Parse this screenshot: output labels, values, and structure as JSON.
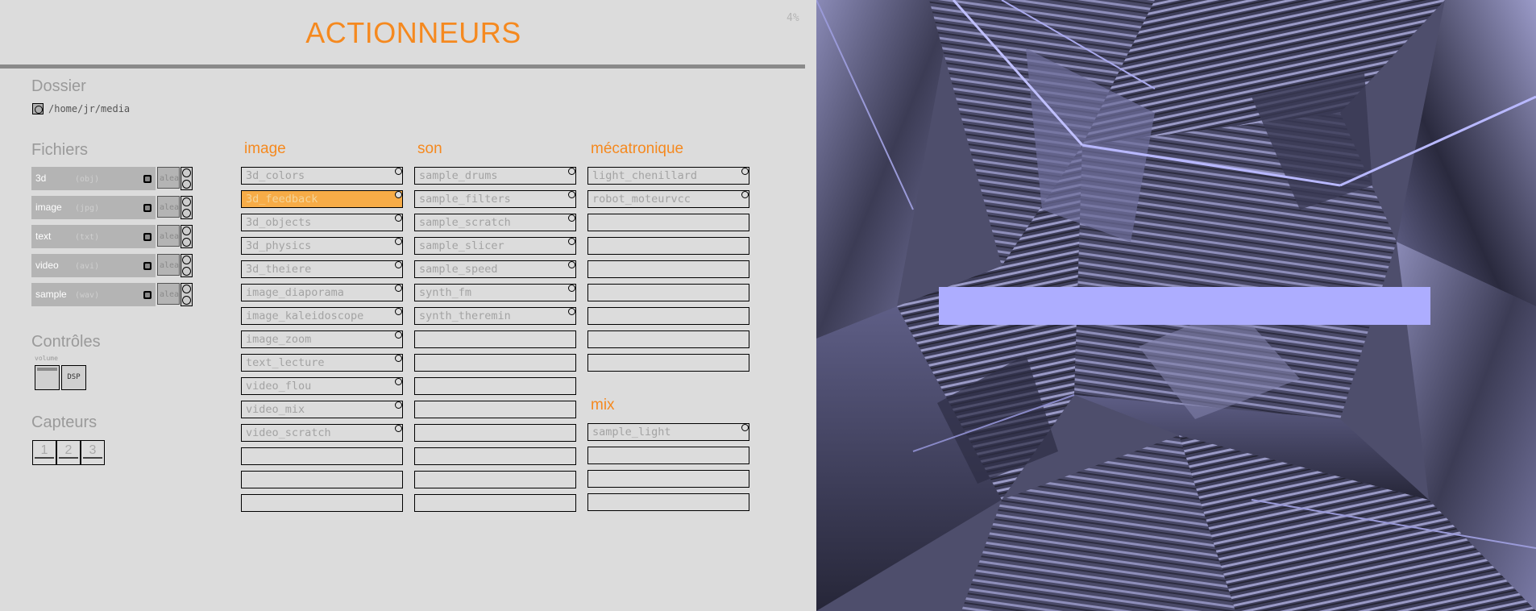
{
  "header": {
    "title": "ACTIONNEURS",
    "percent": "4%"
  },
  "dossier": {
    "heading": "Dossier",
    "path": "/home/jr/media"
  },
  "fichiers": {
    "heading": "Fichiers",
    "items": [
      {
        "name": "3d",
        "ext": "(obj)",
        "alea": "alea"
      },
      {
        "name": "image",
        "ext": "(jpg)",
        "alea": "alea"
      },
      {
        "name": "text",
        "ext": "(txt)",
        "alea": "alea"
      },
      {
        "name": "video",
        "ext": "(avi)",
        "alea": "alea"
      },
      {
        "name": "sample",
        "ext": "(wav)",
        "alea": "alea"
      }
    ]
  },
  "controles": {
    "heading": "Contrôles",
    "volume_label": "volume",
    "dsp_label": "DSP"
  },
  "capteurs": {
    "heading": "Capteurs",
    "buttons": [
      "1",
      "2",
      "3"
    ]
  },
  "columns": {
    "image": {
      "heading": "image",
      "items": [
        "3d_colors",
        "3d_feedback",
        "3d_objects",
        "3d_physics",
        "3d_theiere",
        "image_diaporama",
        "image_kaleidoscope",
        "image_zoom",
        "text_lecture",
        "video_flou",
        "video_mix",
        "video_scratch",
        "",
        "",
        ""
      ]
    },
    "son": {
      "heading": "son",
      "items": [
        "sample_drums",
        "sample_filters",
        "sample_scratch",
        "sample_slicer",
        "sample_speed",
        "synth_fm",
        "synth_theremin",
        "",
        "",
        "",
        "",
        "",
        "",
        "",
        ""
      ]
    },
    "mecatronique": {
      "heading": "mécatronique",
      "items": [
        "light_chenillard",
        "robot_moteurvcc",
        "",
        "",
        "",
        "",
        "",
        "",
        ""
      ]
    },
    "mix": {
      "heading": "mix",
      "items": [
        "sample_light",
        "",
        "",
        ""
      ]
    }
  },
  "active_item": "3d_feedback",
  "colors": {
    "accent": "#f5891f",
    "active_bg": "#f7ac47",
    "viewport_highlight": "#adadff"
  }
}
